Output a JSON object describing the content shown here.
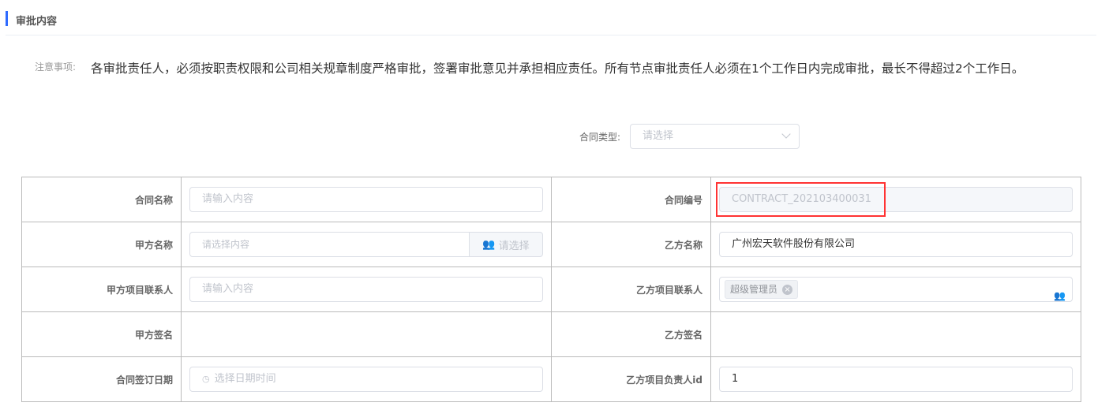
{
  "section": {
    "title": "审批内容"
  },
  "notice": {
    "label": "注意事项:",
    "text": "各审批责任人，必须按职责权限和公司相关规章制度严格审批，签署审批意见并承担相应责任。所有节点审批责任人必须在1个工作日内完成审批，最长不得超过2个工作日。"
  },
  "contract_type": {
    "label": "合同类型:",
    "placeholder": "请选择"
  },
  "form": {
    "contract_name": {
      "label": "合同名称",
      "placeholder": "请输入内容"
    },
    "contract_no": {
      "label": "合同编号",
      "value": "CONTRACT_202103400031"
    },
    "party_a_name": {
      "label": "甲方名称",
      "placeholder": "请选择内容",
      "button": "请选择"
    },
    "party_b_name": {
      "label": "乙方名称",
      "value": "广州宏天软件股份有限公司"
    },
    "party_a_contact": {
      "label": "甲方项目联系人",
      "placeholder": "请输入内容"
    },
    "party_b_contact": {
      "label": "乙方项目联系人",
      "tag": "超级管理员"
    },
    "party_a_sign": {
      "label": "甲方签名"
    },
    "party_b_sign": {
      "label": "乙方签名"
    },
    "sign_date": {
      "label": "合同签订日期",
      "placeholder": "选择日期时间"
    },
    "party_b_owner_id": {
      "label": "乙方项目负责人id",
      "value": "1"
    }
  }
}
